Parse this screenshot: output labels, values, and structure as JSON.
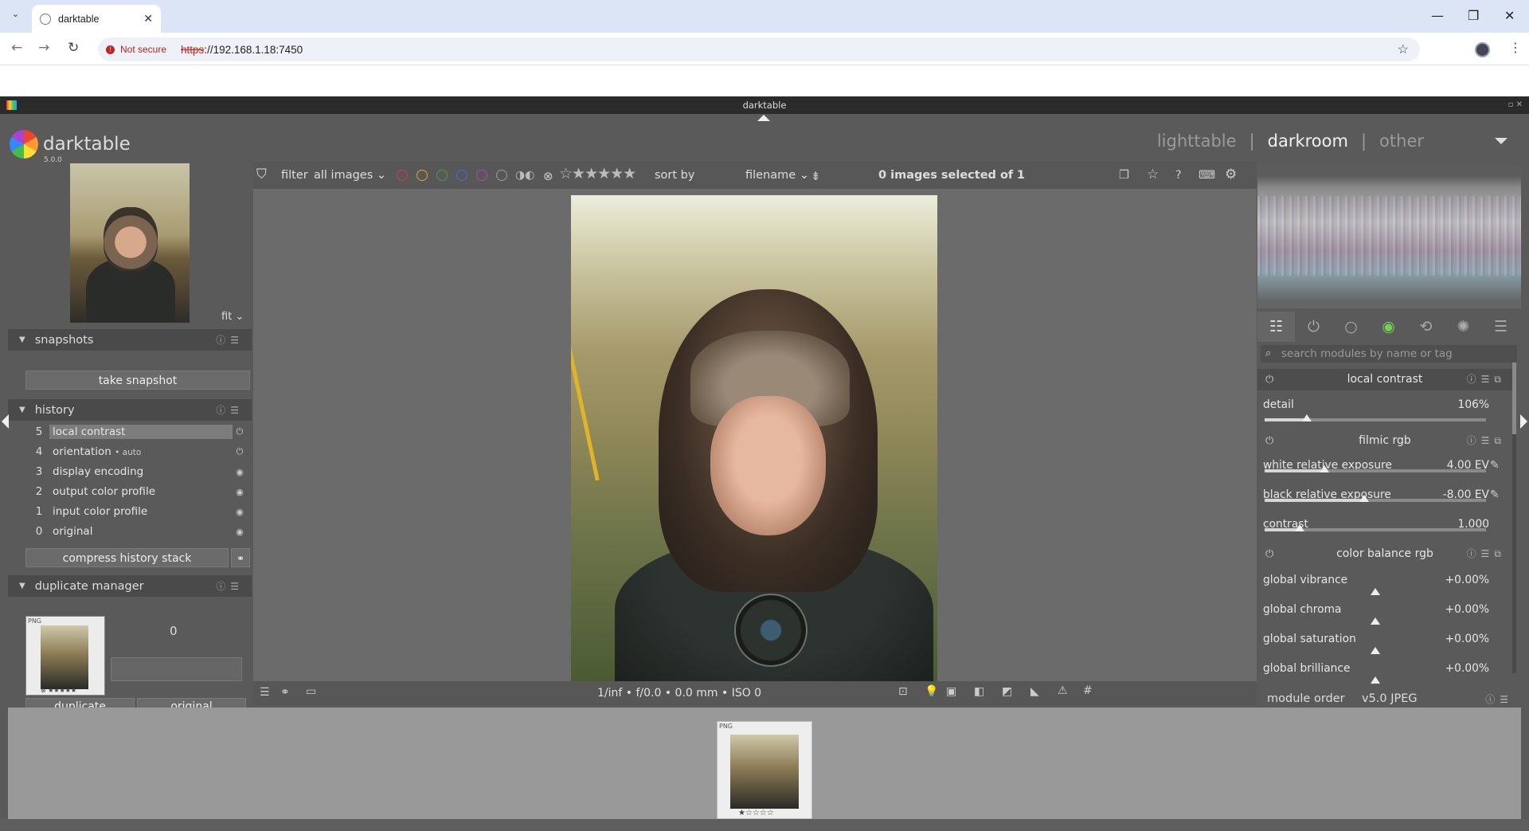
{
  "browser": {
    "tab_title": "darktable",
    "not_secure": "Not secure",
    "url_scheme": "https",
    "url_rest": "://192.168.1.18:7450"
  },
  "window": {
    "title": "darktable"
  },
  "app": {
    "name": "darktable",
    "version": "5.0.0",
    "views": [
      "lighttable",
      "darkroom",
      "other"
    ],
    "active_view": "darkroom"
  },
  "navigation": {
    "zoom": "fit"
  },
  "snapshots": {
    "title": "snapshots",
    "button": "take snapshot"
  },
  "history": {
    "title": "history",
    "items": [
      {
        "n": "5",
        "label": "local contrast",
        "suffix": "",
        "selected": true
      },
      {
        "n": "4",
        "label": "orientation",
        "suffix": "• auto",
        "selected": false
      },
      {
        "n": "3",
        "label": "display encoding",
        "suffix": "",
        "selected": false
      },
      {
        "n": "2",
        "label": "output color profile",
        "suffix": "",
        "selected": false
      },
      {
        "n": "1",
        "label": "input color profile",
        "suffix": "",
        "selected": false
      },
      {
        "n": "0",
        "label": "original",
        "suffix": "",
        "selected": false
      }
    ],
    "compress": "compress history stack"
  },
  "duplicate_manager": {
    "title": "duplicate manager",
    "count": "0",
    "thumb_format": "PNG",
    "buttons": [
      "duplicate",
      "original"
    ]
  },
  "filterbar": {
    "filter_label": "filter",
    "filter_value": "all images",
    "color_labels": [
      "#e03c3c",
      "#e6a21e",
      "#3aa83a",
      "#3a6fe0",
      "#b24ab2",
      "#9a9a9a"
    ],
    "sort_label": "sort by",
    "sort_value": "filename",
    "selected_prefix": "0 images selected of",
    "selected_total": "1"
  },
  "statusbar": {
    "exif": "1/inf • f/0.0 • 0.0 mm • ISO 0"
  },
  "search": {
    "placeholder": "search modules by name or tag"
  },
  "modules": {
    "local_contrast": {
      "title": "local contrast",
      "params": [
        {
          "label": "detail",
          "value": "106%",
          "level": 0.19
        }
      ]
    },
    "filmic_rgb": {
      "title": "filmic rgb",
      "params": [
        {
          "label": "white relative exposure",
          "value": "4.00 EV",
          "level": 0.27
        },
        {
          "label": "black relative exposure",
          "value": "-8.00 EV",
          "level": 0.45
        },
        {
          "label": "contrast",
          "value": "1.000",
          "level": 0.16
        }
      ]
    },
    "color_balance_rgb": {
      "title": "color balance rgb",
      "params": [
        {
          "label": "global vibrance",
          "value": "+0.00%",
          "level": 0.5
        },
        {
          "label": "global chroma",
          "value": "+0.00%",
          "level": 0.5
        },
        {
          "label": "global saturation",
          "value": "+0.00%",
          "level": 0.5
        },
        {
          "label": "global brilliance",
          "value": "+0.00%",
          "level": 0.5
        }
      ]
    }
  },
  "module_order": {
    "label": "module order",
    "value": "v5.0 JPEG"
  },
  "filmstrip": {
    "thumb_format": "PNG"
  }
}
